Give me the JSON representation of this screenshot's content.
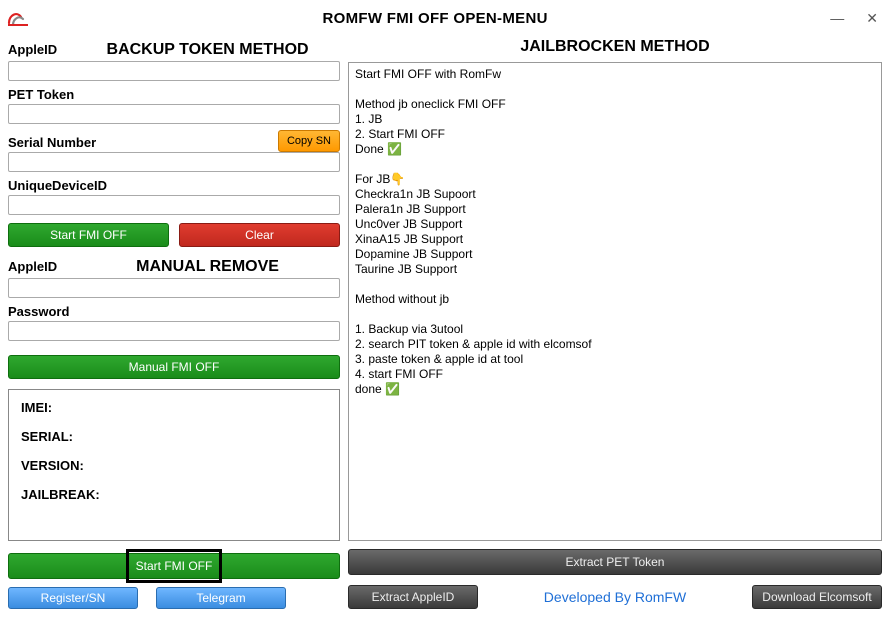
{
  "window": {
    "title": "ROMFW FMI OFF OPEN-MENU"
  },
  "left": {
    "backup_title": "BACKUP TOKEN METHOD",
    "apple_id_label": "AppleID",
    "apple_id_value": "",
    "pet_token_label": "PET Token",
    "pet_token_value": "",
    "serial_label": "Serial Number",
    "serial_value": "",
    "copy_sn_label": "Copy SN",
    "udid_label": "UniqueDeviceID",
    "udid_value": "",
    "start_fmi_label": "Start FMI OFF",
    "clear_label": "Clear",
    "manual_title": "MANUAL REMOVE",
    "manual_apple_id_label": "AppleID",
    "manual_apple_id_value": "",
    "password_label": "Password",
    "password_value": "",
    "manual_fmi_label": "Manual FMI OFF",
    "info": {
      "imei_label": "IMEI:",
      "serial_label": "SERIAL:",
      "version_label": "VERSION:",
      "jailbreak_label": "JAILBREAK:"
    },
    "big_start_label": "Start FMI OFF",
    "register_label": "Register/SN",
    "telegram_label": "Telegram"
  },
  "right": {
    "title": "JAILBROCKEN METHOD",
    "log": "Start FMI OFF with RomFw\n\nMethod jb oneclick FMI OFF\n1. JB\n2. Start FMI OFF\nDone ✅\n\nFor JB👇\nCheckra1n JB Supoort\nPalera1n JB Support\nUnc0ver JB Support\nXinaA15 JB Support\nDopamine JB Support\nTaurine JB Support\n\nMethod without jb\n\n1. Backup via 3utool\n2. search PIT token & apple id with elcomsof\n3. paste token & apple id at tool\n4. start FMI OFF\ndone ✅",
    "extract_pet_label": "Extract PET Token",
    "extract_apple_label": "Extract AppleID",
    "dev_by": "Developed By RomFW",
    "download_elcom_label": "Download Elcomsoft"
  }
}
